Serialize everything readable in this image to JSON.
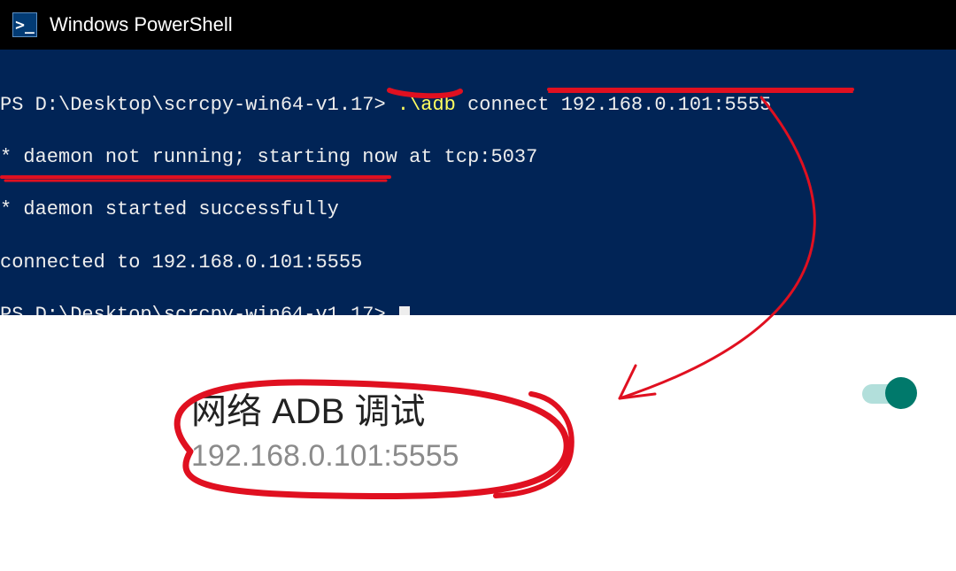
{
  "window": {
    "title": "Windows PowerShell"
  },
  "terminal": {
    "prompt1": "PS D:\\Desktop\\scrcpy-win64-v1.17>",
    "cmd1a": ".\\adb",
    "cmd1b": "connect 192.168.0.101:5555",
    "line2": "* daemon not running; starting now at tcp:5037",
    "line3": "* daemon started successfully",
    "line4": "connected to 192.168.0.101:5555",
    "prompt2": "PS D:\\Desktop\\scrcpy-win64-v1.17>"
  },
  "setting": {
    "title": "网络 ADB 调试",
    "address": "192.168.0.101:5555",
    "toggle_on": true
  }
}
